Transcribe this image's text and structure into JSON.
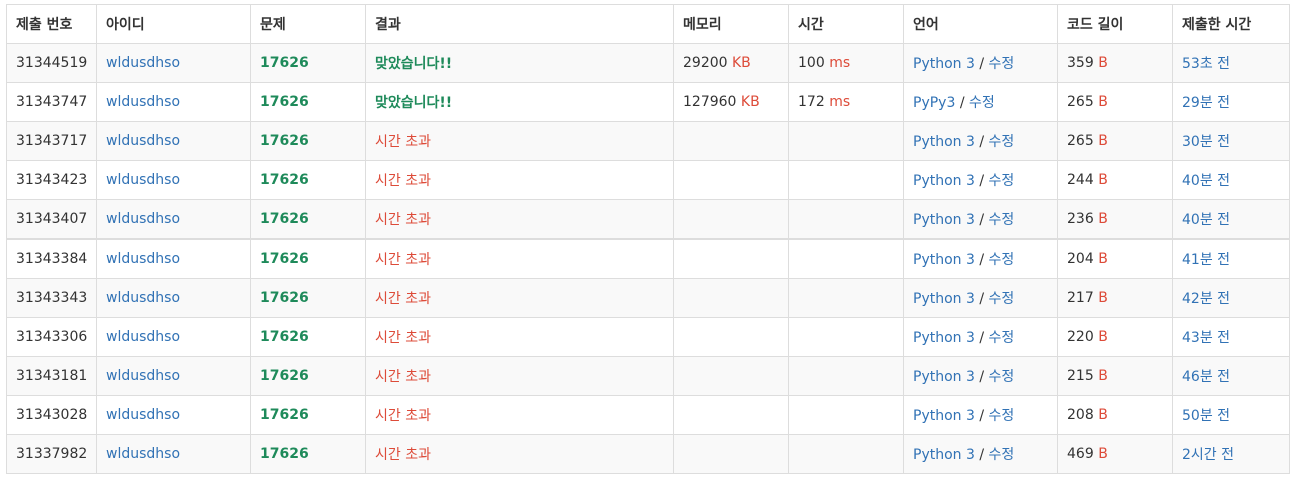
{
  "table": {
    "headers": [
      "제출 번호",
      "아이디",
      "문제",
      "결과",
      "메모리",
      "시간",
      "언어",
      "코드 길이",
      "제출한 시간"
    ],
    "memory_unit": "KB",
    "time_unit": "ms",
    "length_unit": "B",
    "edit_label": "수정",
    "lang_separator": "/",
    "rows": [
      {
        "id": "31344519",
        "user": "wldusdhso",
        "problem": "17626",
        "result": "맞았습니다!!",
        "result_type": "ac",
        "memory": "29200",
        "time": "100",
        "lang": "Python 3",
        "length": "359",
        "submitted": "53초 전"
      },
      {
        "id": "31343747",
        "user": "wldusdhso",
        "problem": "17626",
        "result": "맞았습니다!!",
        "result_type": "ac",
        "memory": "127960",
        "time": "172",
        "lang": "PyPy3",
        "length": "265",
        "submitted": "29분 전"
      },
      {
        "id": "31343717",
        "user": "wldusdhso",
        "problem": "17626",
        "result": "시간 초과",
        "result_type": "tle",
        "memory": "",
        "time": "",
        "lang": "Python 3",
        "length": "265",
        "submitted": "30분 전"
      },
      {
        "id": "31343423",
        "user": "wldusdhso",
        "problem": "17626",
        "result": "시간 초과",
        "result_type": "tle",
        "memory": "",
        "time": "",
        "lang": "Python 3",
        "length": "244",
        "submitted": "40분 전"
      },
      {
        "id": "31343407",
        "user": "wldusdhso",
        "problem": "17626",
        "result": "시간 초과",
        "result_type": "tle",
        "memory": "",
        "time": "",
        "lang": "Python 3",
        "length": "236",
        "submitted": "40분 전"
      },
      {
        "id": "31343384",
        "user": "wldusdhso",
        "problem": "17626",
        "result": "시간 초과",
        "result_type": "tle",
        "memory": "",
        "time": "",
        "lang": "Python 3",
        "length": "204",
        "submitted": "41분 전"
      },
      {
        "id": "31343343",
        "user": "wldusdhso",
        "problem": "17626",
        "result": "시간 초과",
        "result_type": "tle",
        "memory": "",
        "time": "",
        "lang": "Python 3",
        "length": "217",
        "submitted": "42분 전"
      },
      {
        "id": "31343306",
        "user": "wldusdhso",
        "problem": "17626",
        "result": "시간 초과",
        "result_type": "tle",
        "memory": "",
        "time": "",
        "lang": "Python 3",
        "length": "220",
        "submitted": "43분 전"
      },
      {
        "id": "31343181",
        "user": "wldusdhso",
        "problem": "17626",
        "result": "시간 초과",
        "result_type": "tle",
        "memory": "",
        "time": "",
        "lang": "Python 3",
        "length": "215",
        "submitted": "46분 전"
      },
      {
        "id": "31343028",
        "user": "wldusdhso",
        "problem": "17626",
        "result": "시간 초과",
        "result_type": "tle",
        "memory": "",
        "time": "",
        "lang": "Python 3",
        "length": "208",
        "submitted": "50분 전"
      },
      {
        "id": "31337982",
        "user": "wldusdhso",
        "problem": "17626",
        "result": "시간 초과",
        "result_type": "tle",
        "memory": "",
        "time": "",
        "lang": "Python 3",
        "length": "469",
        "submitted": "2시간 전"
      }
    ]
  },
  "colors": {
    "link": "#3172b5",
    "accepted": "#1e8a5a",
    "time_limit_exceeded": "#dd4b39",
    "unit": "#dd4b39",
    "border": "#dddddd"
  }
}
